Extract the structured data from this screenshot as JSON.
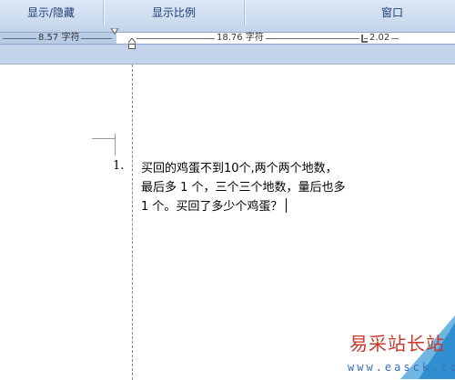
{
  "ribbon": {
    "groups": [
      {
        "label": "显示/隐藏"
      },
      {
        "label": "显示比例"
      },
      {
        "label": "窗口"
      }
    ]
  },
  "ruler": {
    "left_margin": "8.57 字符",
    "text_width": "18.76 字符",
    "right_segment": "2.02"
  },
  "document": {
    "list_number": "1.",
    "lines": [
      "买回的鸡蛋不到10个,两个两个地数，",
      "最后多 1 个，三个三个地数，量后也多",
      "1 个。买回了多少个鸡蛋？"
    ]
  },
  "watermark": {
    "title": "易采站长站",
    "url": "www.easck.com"
  },
  "colors": {
    "ribbon_bg": "#c6d7ec",
    "ribbon_text": "#1e3e73",
    "ruler_bg": "#c3d4ea",
    "watermark_red": "#c9362b",
    "watermark_blue": "#3f6fb5"
  }
}
